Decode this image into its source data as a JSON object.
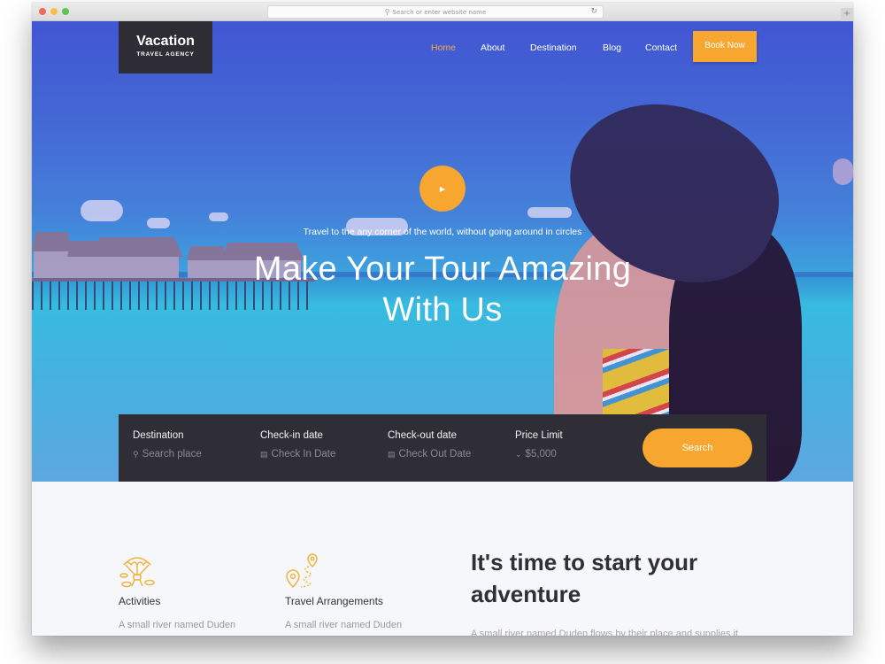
{
  "browser": {
    "url_placeholder": "Search or enter website name",
    "new_tab_label": "+"
  },
  "logo": {
    "name": "Vacation",
    "tagline": "TRAVEL AGENCY"
  },
  "nav": {
    "items": [
      {
        "label": "Home",
        "active": true
      },
      {
        "label": "About",
        "active": false
      },
      {
        "label": "Destination",
        "active": false
      },
      {
        "label": "Blog",
        "active": false
      },
      {
        "label": "Contact",
        "active": false
      }
    ],
    "cta_label": "Book Now"
  },
  "hero": {
    "tagline": "Travel to the any corner of the world, without going around in circles",
    "headline_line1": "Make Your Tour Amazing",
    "headline_line2": "With Us",
    "play_icon": "play-icon"
  },
  "search": {
    "fields": [
      {
        "label": "Destination",
        "placeholder": "Search place",
        "icon": "search-icon"
      },
      {
        "label": "Check-in date",
        "placeholder": "Check In Date",
        "icon": "calendar-icon"
      },
      {
        "label": "Check-out date",
        "placeholder": "Check Out Date",
        "icon": "calendar-icon"
      },
      {
        "label": "Price Limit",
        "value": "$5,000",
        "icon": "chevron-down-icon"
      }
    ],
    "button_label": "Search"
  },
  "features": {
    "items": [
      {
        "title": "Activities",
        "desc": "A small river named Duden",
        "icon": "parachute-icon"
      },
      {
        "title": "Travel Arrangements",
        "desc": "A small river named Duden",
        "icon": "route-map-icon"
      }
    ],
    "heading": "It's time to start your adventure",
    "heading_line1": "It's time to start your",
    "heading_line2": "adventure",
    "body": "A small river named Duden flows by their place and supplies it"
  },
  "colors": {
    "accent": "#f7a630",
    "dark_panel": "#2f2e37",
    "nav_active": "#f7a844"
  }
}
